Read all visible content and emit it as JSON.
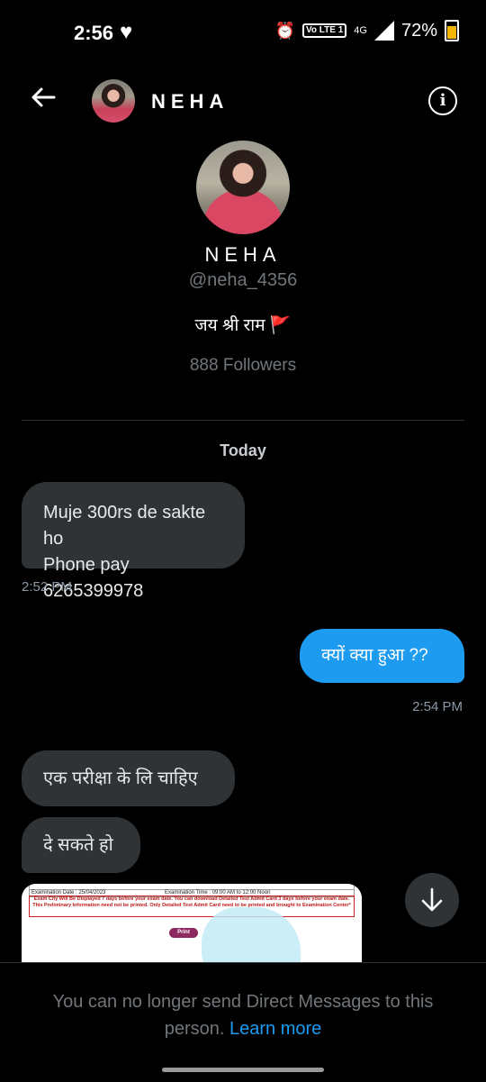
{
  "status_bar": {
    "time": "2:56",
    "battery": "72%",
    "network": "4G",
    "volte": "Vo LTE 1"
  },
  "header": {
    "name": "NEHA",
    "back_icon": "arrow-left-icon",
    "info_icon": "info-icon"
  },
  "profile": {
    "name": "NEHA",
    "handle": "@neha_4356",
    "bio": "जय श्री राम",
    "bio_flag": "🚩",
    "followers": "888 Followers"
  },
  "conversation": {
    "day_label": "Today",
    "messages": [
      {
        "direction": "in",
        "text_line1": "Muje 300rs de sakte ho",
        "text_line2": "Phone pay 6265399978",
        "time": "2:52 PM"
      },
      {
        "direction": "out",
        "text": "क्यों क्या हुआ ??",
        "time": "2:54 PM"
      },
      {
        "direction": "in",
        "text": "एक परीक्षा के लि चाहिए"
      },
      {
        "direction": "in",
        "text": "दे सकते हो"
      }
    ],
    "attachment": {
      "date_left": "Examination Date : 25/04/2023",
      "date_right": "Examination Time : 09:00 AM to 12:00 Noon",
      "notice": "Exam City Will Be Displayed 7 days before your exam date. You can download Detailed Test Admit Card 3 days before your exam date. This Preliminary Information need not be printed. Only Detailed Test Admit Card need to be printed and brought to Examination Center*",
      "print_label": "Print"
    }
  },
  "footer": {
    "message": "You can no longer send Direct Messages to this person.",
    "link": "Learn more"
  },
  "colors": {
    "accent": "#1d9bf0",
    "incoming_bubble": "#2f3336",
    "muted_text": "#71767b"
  }
}
